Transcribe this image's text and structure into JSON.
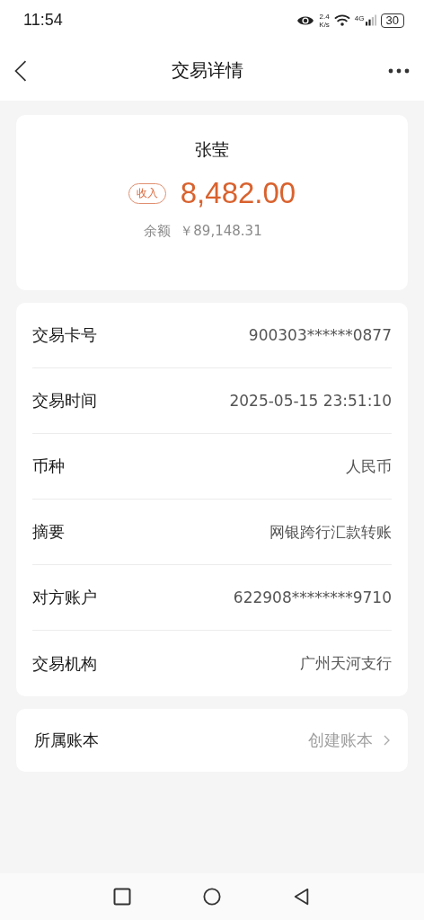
{
  "status_bar": {
    "time": "11:54",
    "speed_value": "2.4",
    "speed_unit": "K/s",
    "network": "4G",
    "battery": "30"
  },
  "header": {
    "title": "交易详情"
  },
  "summary": {
    "name": "张莹",
    "tag": "收入",
    "amount": "8,482.00",
    "balance_label": "余额",
    "balance": "￥89,148.31"
  },
  "details": [
    {
      "label": "交易卡号",
      "value": "900303******0877"
    },
    {
      "label": "交易时间",
      "value": "2025-05-15 23:51:10"
    },
    {
      "label": "币种",
      "value": "人民币"
    },
    {
      "label": "摘要",
      "value": "网银跨行汇款转账"
    },
    {
      "label": "对方账户",
      "value": "622908********9710"
    },
    {
      "label": "交易机构",
      "value": "广州天河支行"
    }
  ],
  "ledger": {
    "label": "所属账本",
    "action": "创建账本"
  }
}
